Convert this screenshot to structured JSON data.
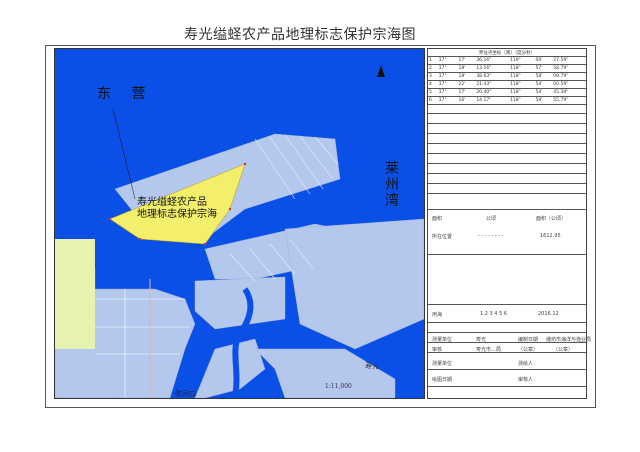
{
  "title": "寿光缢蛏农产品地理标志保护宗海图",
  "map": {
    "labels": {
      "dongying": "东  营",
      "laizhou": "莱州湾",
      "zone": "寿光缢蛏农产品\n地理标志保护宗海",
      "scale": "1:11,000",
      "river": "弥河口",
      "north": "N",
      "logo": "寿光"
    },
    "colors": {
      "sea": "#0a50e6",
      "land": "#b4c8ee",
      "zone": "#f2f06a",
      "green": "#e6f2b0"
    }
  },
  "panel": {
    "coord_table": {
      "header": "界址点坐标（南）（度分秒）",
      "rows": [
        [
          "1",
          "37°",
          "17'",
          "36.16\"",
          "119°",
          "00'",
          "27.59\""
        ],
        [
          "2",
          "37°",
          "18'",
          "13.16\"",
          "118°",
          "57'",
          "58.79\""
        ],
        [
          "3",
          "37°",
          "18'",
          "38.63\"",
          "118°",
          "58'",
          "09.79\""
        ],
        [
          "4",
          "37°",
          "22'",
          "21.43\"",
          "118°",
          "54'",
          "00.59\""
        ],
        [
          "5",
          "37°",
          "17'",
          "20.40\"",
          "118°",
          "54'",
          "45.39\""
        ],
        [
          "6",
          "37°",
          "16'",
          "14.17\"",
          "118°",
          "59'",
          "55.79\""
        ]
      ]
    },
    "info": {
      "area_label": "面积",
      "area_unit": "公顷",
      "area_value": "面积（公顷）",
      "value_1": "1612.95",
      "location_label": "所在位置",
      "dots": "- - - - - - - -",
      "row_label": "用海",
      "codes": "1 2 3 4 5 6",
      "year": "2016.12"
    },
    "footer": {
      "r1": [
        "测量单位",
        "寿光",
        "编制日期",
        "潍坊市海洋与渔业局"
      ],
      "r2": [
        "审核",
        "寿光市…局",
        "（公章）",
        "（公章）"
      ],
      "r3": [
        "测量单位",
        "",
        "测绘人",
        ""
      ],
      "r4": [
        "绘图日期",
        "",
        "审核人",
        ""
      ]
    }
  }
}
